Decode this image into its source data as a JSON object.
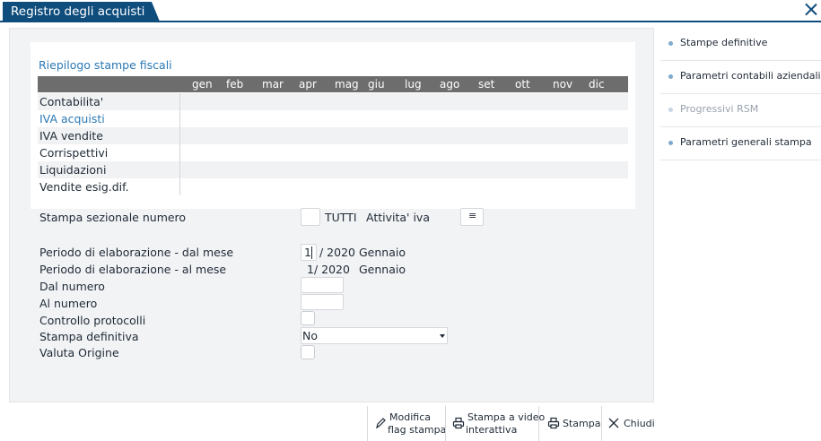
{
  "window": {
    "title": "Registro degli acquisti"
  },
  "summary": {
    "title": "Riepilogo stampe fiscali",
    "months": [
      "gen",
      "feb",
      "mar",
      "apr",
      "mag",
      "giu",
      "lug",
      "ago",
      "set",
      "ott",
      "nov",
      "dic"
    ],
    "rows": [
      "Contabilita'",
      "IVA acquisti",
      "IVA vendite",
      "Corrispettivi",
      "Liquidazioni",
      "Vendite esig.dif."
    ]
  },
  "form": {
    "sezionale_label": "Stampa sezionale numero",
    "tutti": "TUTTI",
    "attivita_label": "Attivita' iva",
    "attivita_value": "≡",
    "periodo_dal_label": "Periodo di elaborazione - dal mese",
    "periodo_dal_month": "1",
    "periodo_dal_year": "/ 2020",
    "periodo_dal_name": "Gennaio",
    "periodo_al_label": "Periodo di elaborazione - al mese",
    "periodo_al_value": "1/ 2020",
    "periodo_al_name": "Gennaio",
    "dal_numero_label": "Dal numero",
    "al_numero_label": "Al numero",
    "controllo_label": "Controllo protocolli",
    "stampa_def_label": "Stampa definitiva",
    "stampa_def_value": "No",
    "valuta_label": "Valuta Origine"
  },
  "side_menu": {
    "items": [
      {
        "label": "Stampe definitive",
        "enabled": true
      },
      {
        "label": "Parametri contabili aziendali",
        "enabled": true
      },
      {
        "label": "Progressivi RSM",
        "enabled": false
      },
      {
        "label": "Parametri generali stampa",
        "enabled": true
      }
    ]
  },
  "toolbar": {
    "modifica_line1": "Modifica",
    "modifica_line2": "flag stampa",
    "video_line1": "Stampa a video",
    "video_line2": "interattiva",
    "stampa": "Stampa",
    "chiudi": "Chiudi"
  },
  "colors": {
    "accent": "#0f4d7d",
    "link": "#2b78b5",
    "header_bg": "#6d6d6d"
  }
}
